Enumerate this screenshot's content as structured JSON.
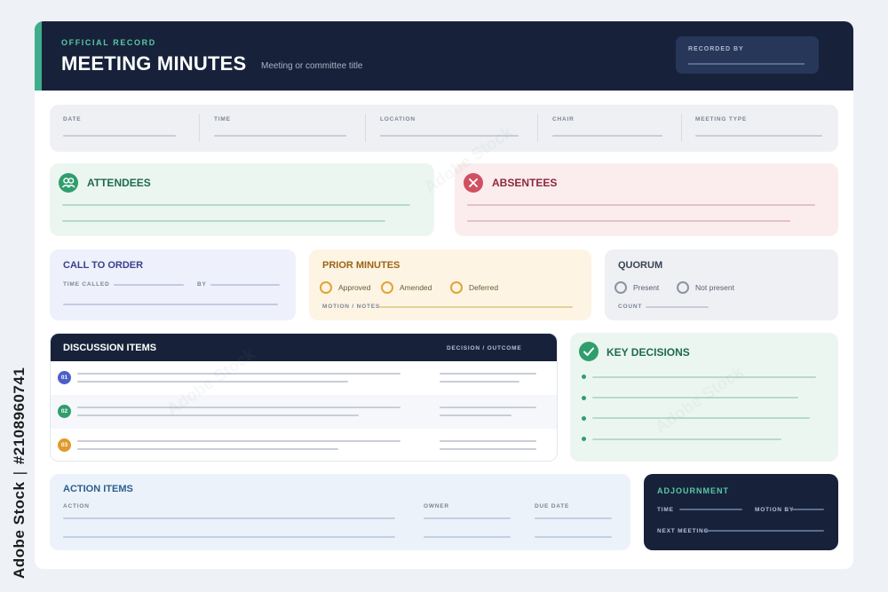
{
  "header": {
    "kicker": "OFFICIAL RECORD",
    "title": "MEETING MINUTES",
    "subtitle": "Meeting or committee title",
    "recorded_by_label": "RECORDED BY"
  },
  "info": {
    "fields": [
      "DATE",
      "TIME",
      "LOCATION",
      "CHAIR",
      "MEETING TYPE"
    ]
  },
  "attendees": {
    "title": "ATTENDEES"
  },
  "absentees": {
    "title": "ABSENTEES"
  },
  "call_to_order": {
    "title": "CALL TO ORDER",
    "time_called_label": "TIME CALLED",
    "by_label": "BY"
  },
  "prior_minutes": {
    "title": "PRIOR MINUTES",
    "options": [
      "Approved",
      "Amended",
      "Deferred"
    ],
    "notes_label": "MOTION / NOTES"
  },
  "quorum": {
    "title": "QUORUM",
    "options": [
      "Present",
      "Not present"
    ],
    "count_label": "COUNT"
  },
  "discussion": {
    "title": "DISCUSSION ITEMS",
    "outcome_label": "DECISION / OUTCOME",
    "items": [
      "01",
      "02",
      "03"
    ]
  },
  "key_decisions": {
    "title": "KEY DECISIONS"
  },
  "action_items": {
    "title": "ACTION ITEMS",
    "columns": [
      "ACTION",
      "OWNER",
      "DUE DATE"
    ]
  },
  "adjournment": {
    "title": "ADJOURNMENT",
    "time_label": "TIME",
    "motion_by_label": "MOTION BY",
    "next_meeting_label": "NEXT MEETING"
  },
  "watermark": {
    "side_text_1": "Adobe Stock",
    "side_separator": "|",
    "side_text_2": "#2108960741",
    "tile_text": "Adobe Stock"
  },
  "colors": {
    "navy": "#17223a",
    "teal_accent": "#3fae8c",
    "green_panel": "#ecf6f1",
    "red_panel": "#fbecee",
    "lavender_panel": "#eef0fb",
    "amber_panel": "#fdf4e3",
    "grey_panel": "#eef0f4",
    "blue_panel": "#ecf2fa"
  }
}
